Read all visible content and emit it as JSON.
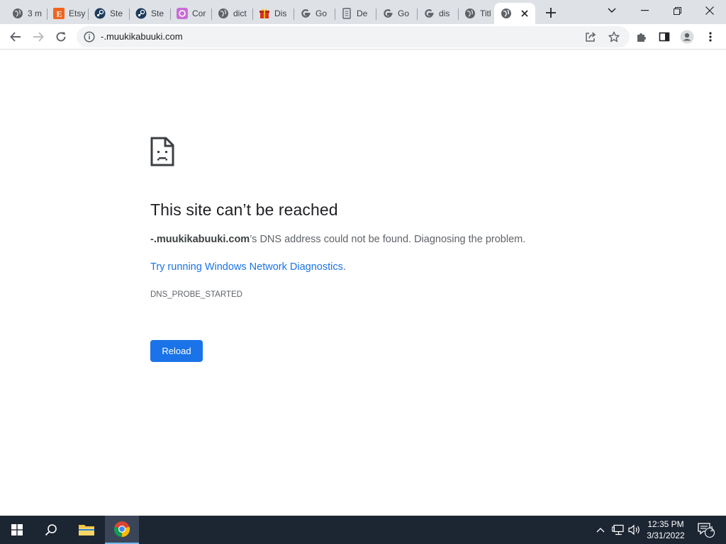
{
  "browser": {
    "tabs": [
      {
        "title": "3 m",
        "icon": "globe-icon"
      },
      {
        "title": "Etsy",
        "icon": "etsy-icon"
      },
      {
        "title": "Ste",
        "icon": "steam-icon"
      },
      {
        "title": "Ste",
        "icon": "steam-icon"
      },
      {
        "title": "Cor",
        "icon": "purple-app-icon"
      },
      {
        "title": "dict",
        "icon": "globe-icon"
      },
      {
        "title": "Dis",
        "icon": "gift-icon"
      },
      {
        "title": "Go",
        "icon": "google-icon"
      },
      {
        "title": "De",
        "icon": "document-icon"
      },
      {
        "title": "Go",
        "icon": "google-icon"
      },
      {
        "title": "dis",
        "icon": "google-icon"
      },
      {
        "title": "Titl",
        "icon": "globe-icon"
      },
      {
        "title": "",
        "icon": "globe-icon",
        "active": true
      }
    ],
    "url": "-.muukikabuuki.com"
  },
  "error_page": {
    "title": "This site can’t be reached",
    "host": "-.muukikabuuki.com",
    "message_suffix": "’s DNS address could not be found. Diagnosing the problem.",
    "link_text": "Try running Windows Network Diagnostics",
    "link_suffix": ".",
    "error_code": "DNS_PROBE_STARTED",
    "reload_label": "Reload"
  },
  "taskbar": {
    "time": "12:35 PM",
    "date": "3/31/2022",
    "notification_count": "1"
  },
  "colors": {
    "accent": "#1a73e8",
    "tabstrip": "#dee1e6",
    "taskbar": "#1c2532"
  }
}
